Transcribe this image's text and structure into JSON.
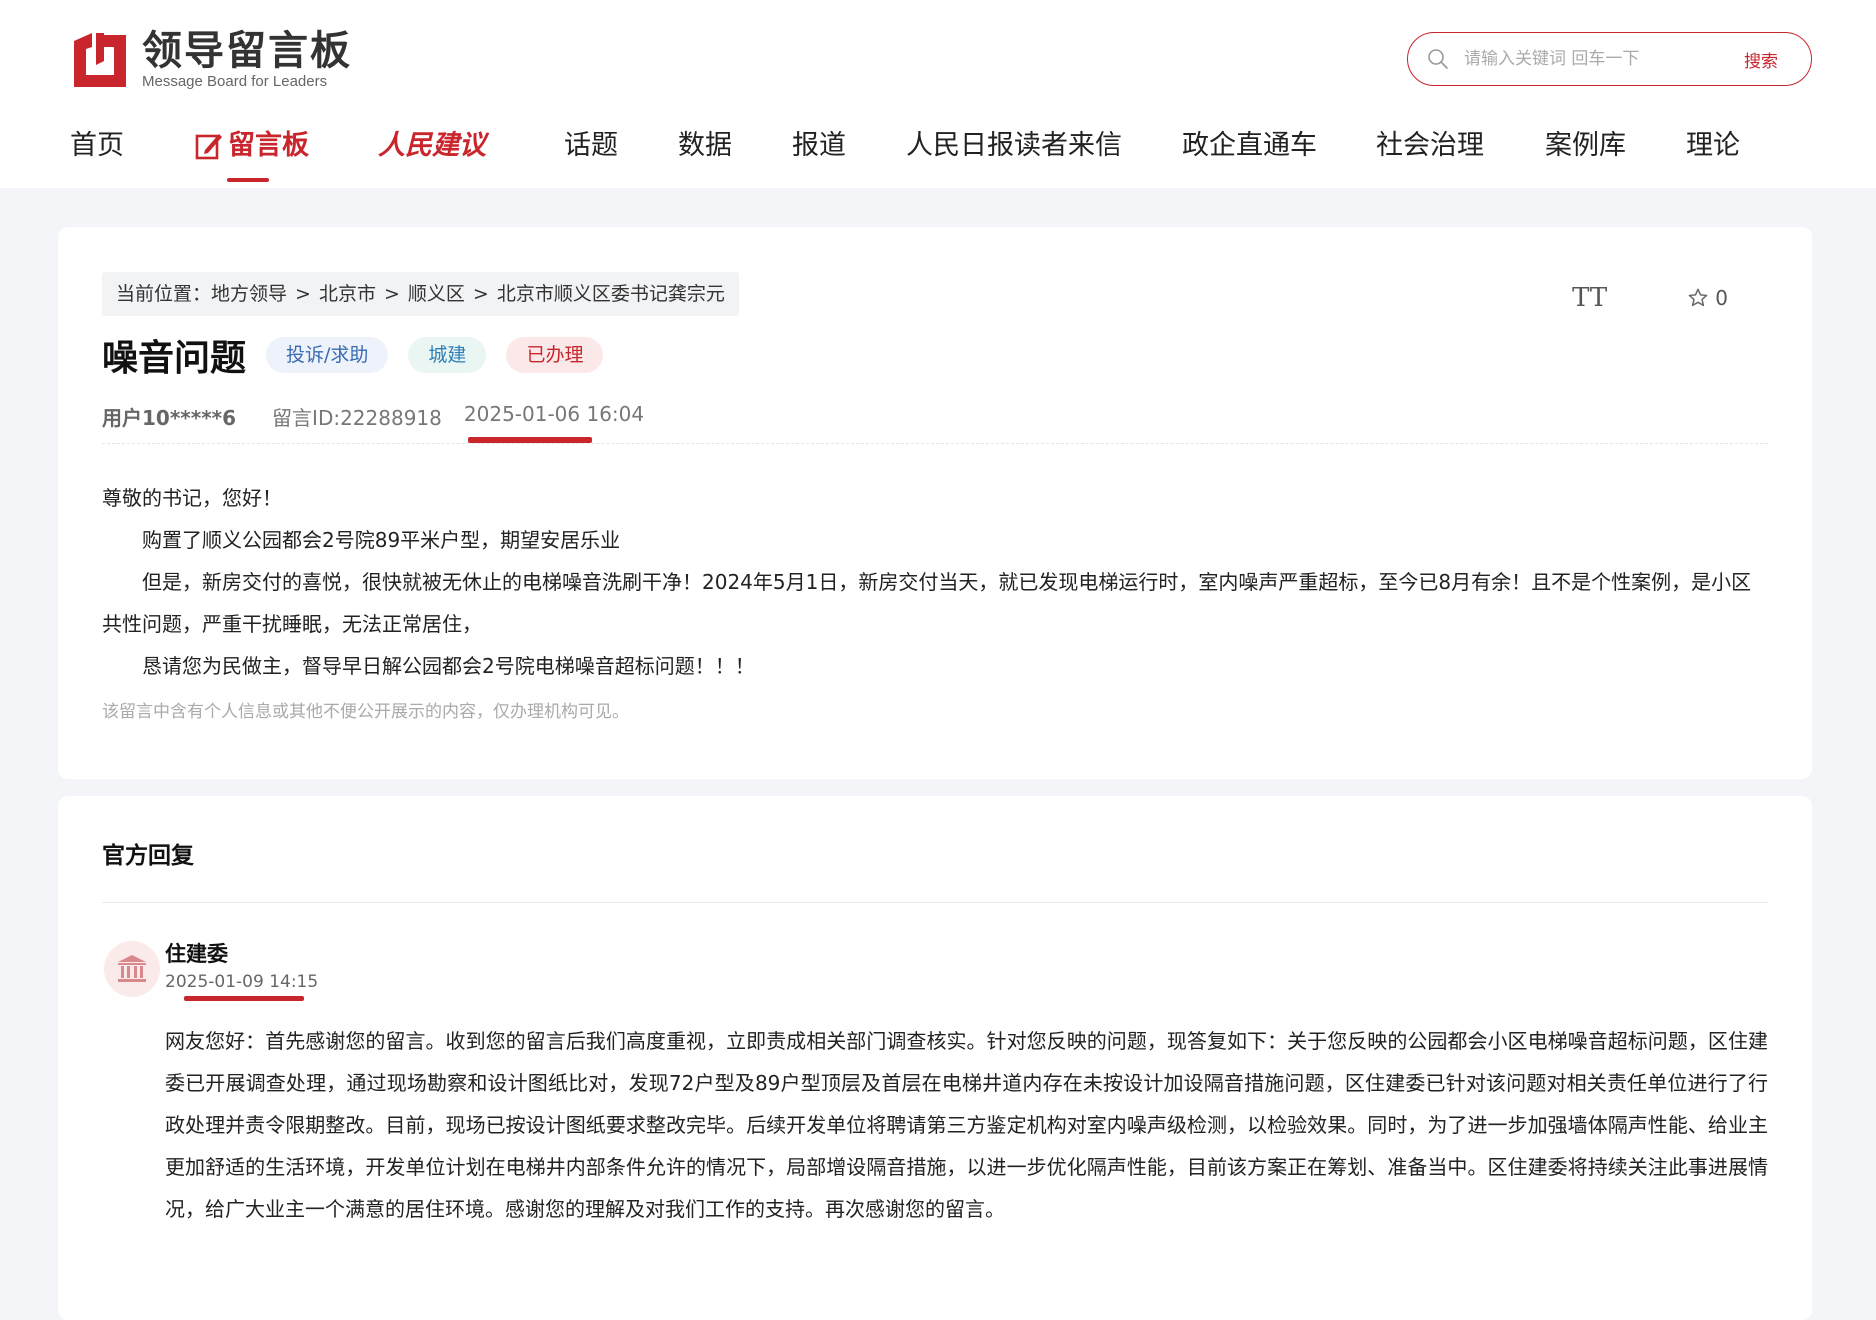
{
  "header": {
    "logo_cn": "领导留言板",
    "logo_en": "Message Board for Leaders",
    "search_placeholder": "请输入关键词 回车一下",
    "search_button": "搜索"
  },
  "nav": [
    {
      "label": "首页"
    },
    {
      "label": "留言板"
    },
    {
      "label": "人民建议"
    },
    {
      "label": "话题"
    },
    {
      "label": "数据"
    },
    {
      "label": "报道"
    },
    {
      "label": "人民日报读者来信"
    },
    {
      "label": "政企直通车"
    },
    {
      "label": "社会治理"
    },
    {
      "label": "案例库"
    },
    {
      "label": "理论"
    }
  ],
  "message": {
    "breadcrumb_prefix": "当前位置：",
    "breadcrumb": [
      "地方领导",
      "北京市",
      "顺义区",
      "北京市顺义区委书记龚宗元"
    ],
    "breadcrumb_sep": ">",
    "font_toggle": "TT",
    "favorite_count": "0",
    "title": "噪音问题",
    "tags": [
      "投诉/求助",
      "城建",
      "已办理"
    ],
    "user": "用户10*****6",
    "message_id": "留言ID:22288918",
    "date": "2025-01-06 16:04",
    "body": [
      "尊敬的书记，您好！",
      "购置了顺义公园都会2号院89平米户型，期望安居乐业",
      "但是，新房交付的喜悦，很快就被无休止的电梯噪音洗刷干净！2024年5月1日，新房交付当天，就已发现电梯运行时，室内噪声严重超标，至今已8月有余！且不是个性案例，是小区共性问题，严重干扰睡眠，无法正常居住，",
      "恳请您为民做主，督导早日解公园都会2号院电梯噪音超标问题！！！"
    ],
    "privacy_note": "该留言中含有个人信息或其他不便公开展示的内容，仅办理机构可见。"
  },
  "reply": {
    "section_title": "官方回复",
    "department": "住建委",
    "date": "2025-01-09 14:15",
    "body": "网友您好：首先感谢您的留言。收到您的留言后我们高度重视，立即责成相关部门调查核实。针对您反映的问题，现答复如下：关于您反映的公园都会小区电梯噪音超标问题，区住建委已开展调查处理，通过现场勘察和设计图纸比对，发现72户型及89户型顶层及首层在电梯井道内存在未按设计加设隔音措施问题，区住建委已针对该问题对相关责任单位进行了行政处理并责令限期整改。目前，现场已按设计图纸要求整改完毕。后续开发单位将聘请第三方鉴定机构对室内噪声级检测，以检验效果。同时，为了进一步加强墙体隔声性能、给业主更加舒适的生活环境，开发单位计划在电梯井内部条件允许的情况下，局部增设隔音措施，以进一步优化隔声性能，目前该方案正在筹划、准备当中。区住建委将持续关注此事进展情况，给广大业主一个满意的居住环境。感谢您的理解及对我们工作的支持。再次感谢您的留言。"
  },
  "colors": {
    "brand_red": "#c9252c",
    "background": "#f3f5f8"
  }
}
